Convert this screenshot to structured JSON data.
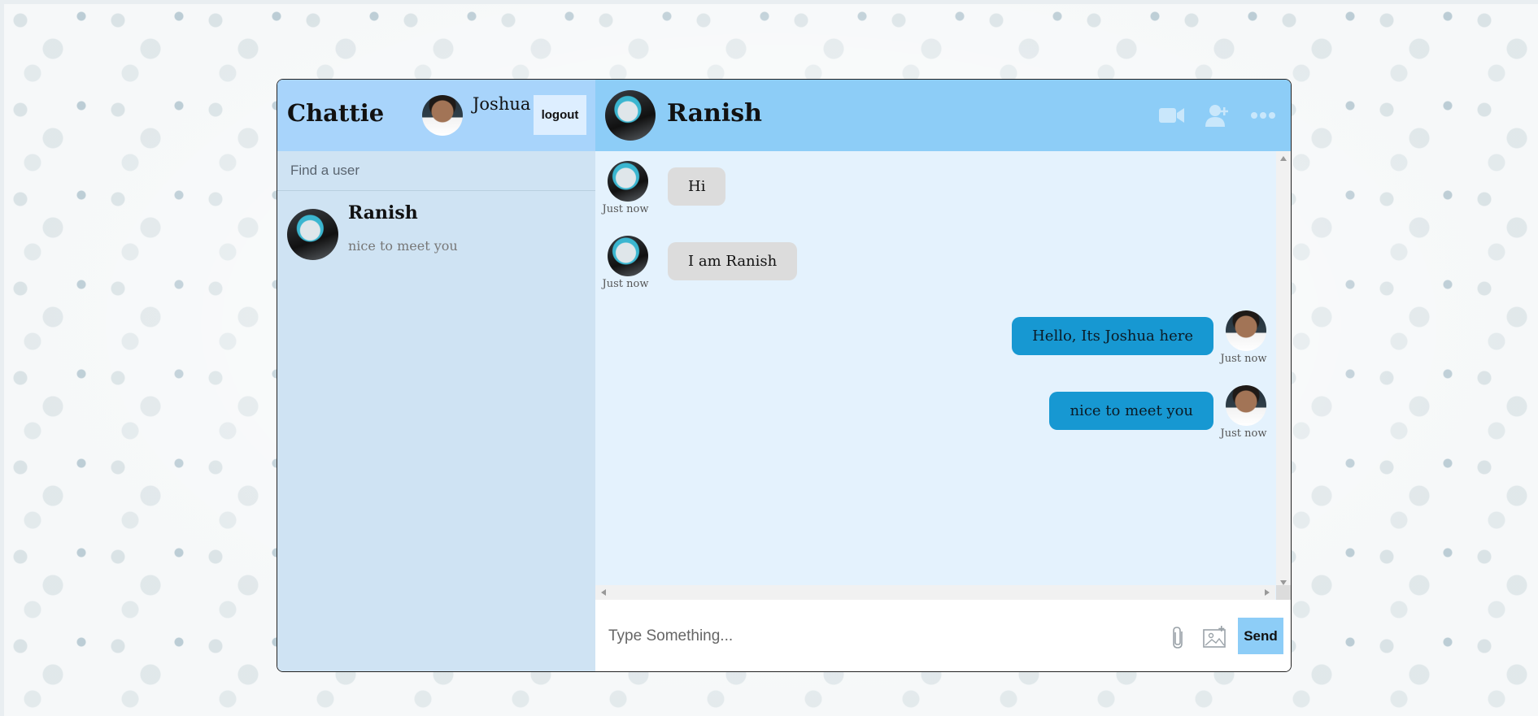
{
  "app": {
    "brand": "Chattie"
  },
  "current_user": {
    "name": "Joshua"
  },
  "logout_label": "logout",
  "search": {
    "placeholder": "Find a user"
  },
  "conversations": [
    {
      "name": "Ranish",
      "last_message": "nice to meet you"
    }
  ],
  "chat": {
    "contact_name": "Ranish",
    "messages": [
      {
        "text": "Hi",
        "time": "Just now",
        "from": "Ranish"
      },
      {
        "text": "I am Ranish",
        "time": "Just now",
        "from": "Ranish"
      },
      {
        "text": "Hello, Its Joshua here",
        "time": "Just now",
        "from": "Joshua"
      },
      {
        "text": "nice to meet you",
        "time": "Just now",
        "from": "Joshua"
      }
    ]
  },
  "composer": {
    "placeholder": "Type Something...",
    "send_label": "Send"
  },
  "icons": [
    "video-camera-icon",
    "add-user-icon",
    "more-icon",
    "paperclip-icon",
    "image-icon"
  ],
  "colors": {
    "sidebar_header": "#a8d4fb",
    "chat_header": "#8dcdf7",
    "outgoing_bubble": "#1798d2",
    "incoming_bubble": "#dcdcdc"
  }
}
